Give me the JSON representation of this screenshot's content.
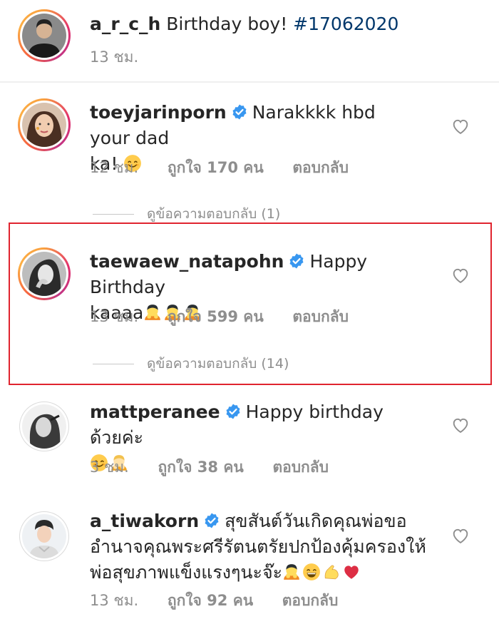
{
  "comments": [
    {
      "username": "a_r_c_h",
      "verified": false,
      "text": "Birthday boy!",
      "hashtag": "#17062020",
      "time": "13 ชม.",
      "avatar": "caption-author-avatar"
    },
    {
      "username": "toeyjarinporn",
      "verified": true,
      "text_line1": "Narakkkk hbd your dad",
      "text_line2": "ka!",
      "emojis": [
        "smiling-face-emoji"
      ],
      "time": "12 ชม.",
      "likes": "ถูกใจ 170 คน",
      "reply": "ตอบกลับ",
      "view_replies": "ดูข้อความตอบกลับ (1)"
    },
    {
      "username": "taewaew_natapohn",
      "verified": true,
      "text_line1": "Happy Birthday",
      "text_line2": "kaaaa",
      "emojis": [
        "person-bowing-emoji",
        "person-bowing-emoji",
        "person-bowing-emoji"
      ],
      "time": "13 ชม.",
      "likes": "ถูกใจ 599 คน",
      "reply": "ตอบกลับ",
      "view_replies": "ดูข้อความตอบกลับ (14)",
      "highlighted": true
    },
    {
      "username": "mattperanee",
      "verified": true,
      "text_line1": "Happy birthday ด้วยค่ะ",
      "emojis": [
        "smiling-face-emoji",
        "person-bowing-emoji"
      ],
      "time": "3 ชม.",
      "likes": "ถูกใจ 38 คน",
      "reply": "ตอบกลับ"
    },
    {
      "username": "a_tiwakorn",
      "verified": true,
      "text_line1": "สุขสันต์วันเกิดคุณพ่อขอ",
      "text_line2": "อำนาจคุณพระศรีรัตนตรัยปกป้องคุ้มครองให้",
      "text_line3": "พ่อสุขภาพแข็งแรงๆนะจ๊ะ",
      "emojis": [
        "person-bowing-emoji",
        "grinning-face-emoji",
        "flexed-biceps-emoji",
        "red-heart-emoji"
      ],
      "time": "13 ชม.",
      "likes": "ถูกใจ 92 คน",
      "reply": "ตอบกลับ"
    }
  ],
  "colors": {
    "text": "#262626",
    "muted": "#8e8e8e",
    "verified_blue": "#3897f0",
    "hashtag": "#00376b",
    "highlight_border": "#e0242f",
    "heart_red": "#ed4956"
  },
  "icons": [
    "heart-outline-icon",
    "verified-badge-icon"
  ]
}
